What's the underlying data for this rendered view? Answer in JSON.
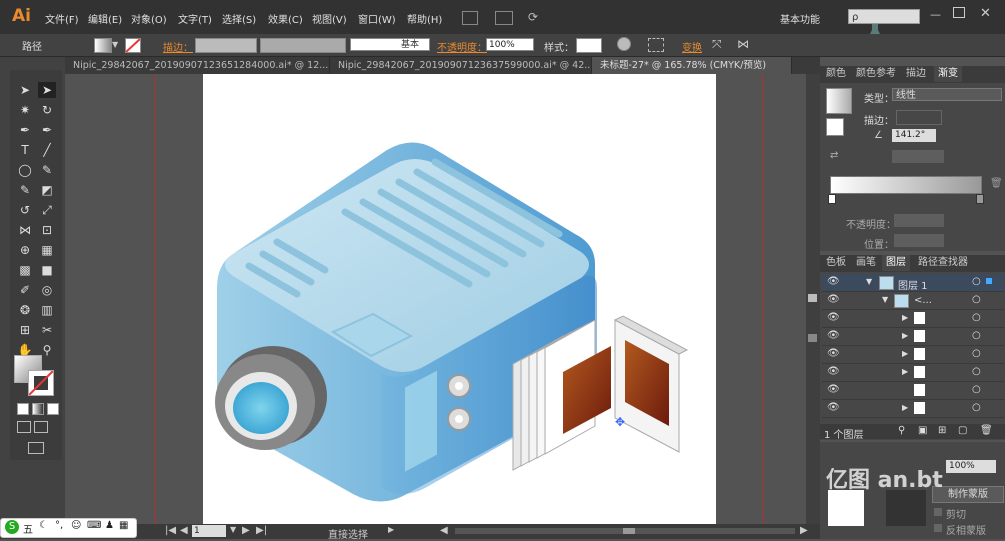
{
  "app": {
    "logo": "Ai",
    "workspace": "基本功能",
    "search_placeholder": "ρ"
  },
  "menu": [
    "文件(F)",
    "编辑(E)",
    "对象(O)",
    "文字(T)",
    "选择(S)",
    "效果(C)",
    "视图(V)",
    "窗口(W)",
    "帮助(H)"
  ],
  "control_bar": {
    "selection_label": "路径",
    "stroke_label": "描边：",
    "brush_label": "基本",
    "opacity_label": "不透明度：",
    "opacity_value": "100%",
    "style_label": "样式：",
    "transform_label": "变换"
  },
  "doc_tabs": [
    "Nipic_29842067_20190907123651284000.ai* @ 12...",
    "Nipic_29842067_20190907123637599000.ai* @ 42...",
    "未标题-27* @ 165.78% (CMYK/预览)"
  ],
  "gradient_panel": {
    "tabs": [
      "颜色",
      "颜色参考",
      "描边",
      "渐变"
    ],
    "type_label": "类型：",
    "type_value": "线性",
    "stroke_label": "描边：",
    "angle_value": "141.2°",
    "opacity_label": "不透明度：",
    "position_label": "位置："
  },
  "layers_panel": {
    "tabs": [
      "色板",
      "画笔",
      "图层",
      "路径查找器"
    ],
    "layer_name": "图层 1",
    "group_name": "<...",
    "count_label": "1 个图层",
    "make_mask": "制作蒙版",
    "clip_label": "剪切",
    "invert_mask": "反相蒙版"
  },
  "status": {
    "zoom": "165.7",
    "page": "1",
    "tool": "直接选择"
  },
  "ime": {
    "label": "五"
  },
  "watermark": "亿图 an.bt"
}
